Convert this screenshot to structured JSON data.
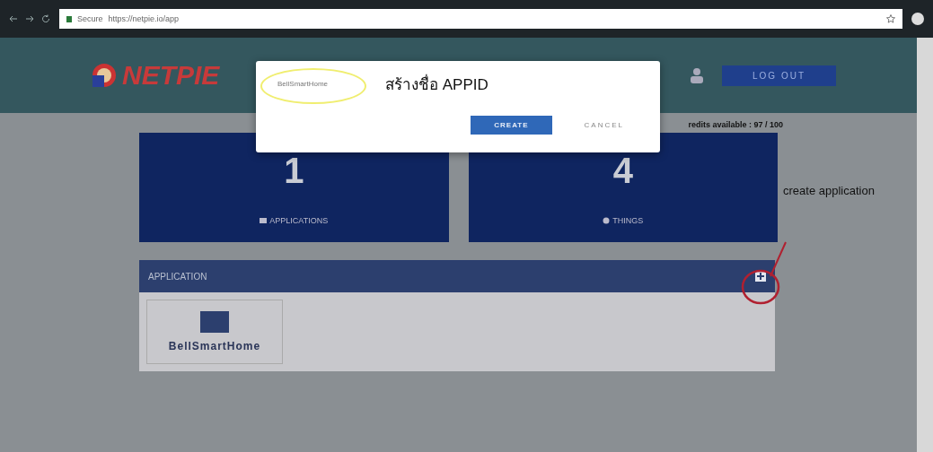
{
  "browser": {
    "security": "Secure",
    "url": "https://netpie.io/app"
  },
  "header": {
    "logo": "NETPIE",
    "logout": "LOG OUT"
  },
  "credits": "redits available : 97 / 100",
  "stats": [
    {
      "kind": "applications",
      "value": "1",
      "label": "APPLICATIONS"
    },
    {
      "kind": "things",
      "value": "4",
      "label": "THINGS"
    }
  ],
  "application_panel": {
    "title": "APPLICATION",
    "apps": [
      {
        "name": "BellSmartHome"
      }
    ]
  },
  "dialog": {
    "value": "BellSmartHome",
    "caption": "สร้างชื่อ APPID",
    "buttons": [
      {
        "kind": "primary",
        "label": "CREATE"
      },
      {
        "kind": "text",
        "label": "CANCEL"
      }
    ]
  },
  "annotation": {
    "text": "create application"
  }
}
